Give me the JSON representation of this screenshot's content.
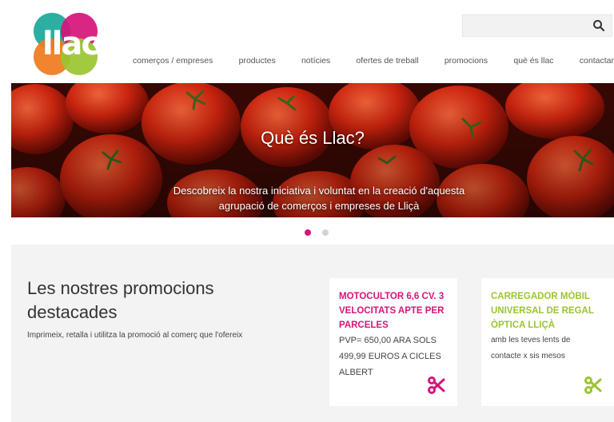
{
  "brand": {
    "logo_text": "llac"
  },
  "search": {
    "placeholder": ""
  },
  "nav": {
    "items": [
      "comerços / empreses",
      "productes",
      "notícies",
      "ofertes de treball",
      "promocions",
      "què és llac",
      "contactar"
    ]
  },
  "hero": {
    "title": "Què és Llac?",
    "subtitle": "Descobreix la nostra iniciativa i voluntat en la creació d'aquesta agrupació de comerços i empreses de Lliçà"
  },
  "carousel": {
    "active": 1,
    "count": 2
  },
  "promos": {
    "title": "Les nostres promocions destacades",
    "description": "Imprimeix, retalla i utilitza la promoció al comerç que l'ofereix",
    "cards": [
      {
        "title": "MOTOCULTOR 6,6 CV. 3 VELOCITATS APTE PER PARCELES",
        "text": "PVP= 650,00 ARA SOLS 499,99 EUROS A CICLES ALBERT",
        "accent": "#d6137a"
      },
      {
        "title": "CARREGADOR MÒBIL UNIVERSAL DE REGAL ÒPTICA LLIÇÀ",
        "text": "amb les teves lents de contacte x sis mesos",
        "accent": "#9ac531"
      }
    ]
  },
  "colors": {
    "brand_teal": "#1aa79a",
    "brand_magenta": "#d6137a",
    "brand_orange": "#f07a1d",
    "brand_green": "#9ac531"
  },
  "icons": {
    "search": "search-icon",
    "scissors": "scissors-icon"
  }
}
